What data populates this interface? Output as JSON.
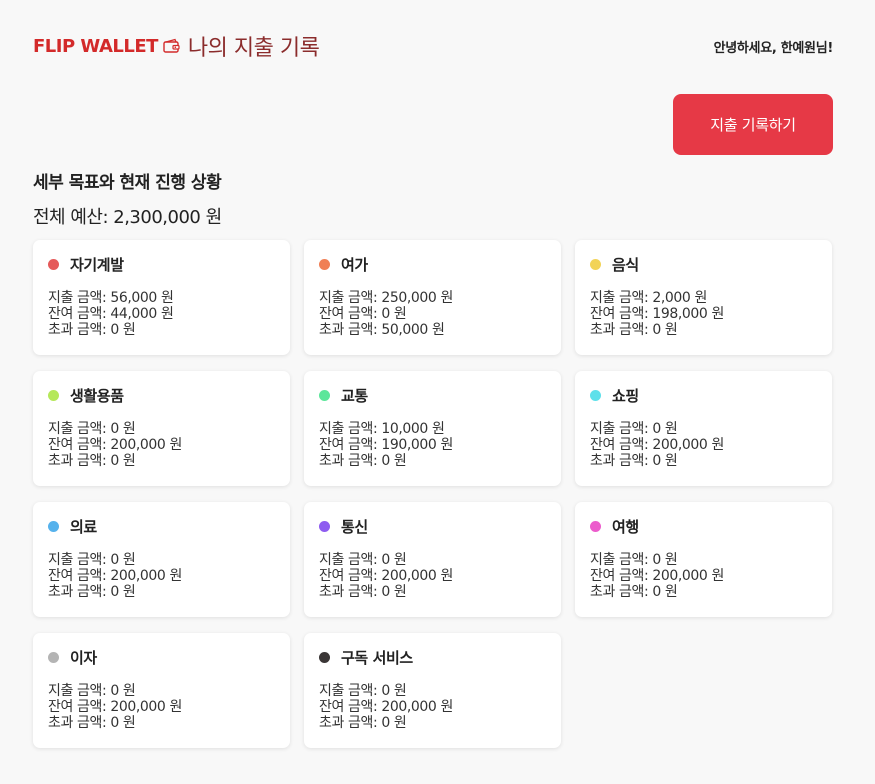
{
  "header": {
    "brand": "FLIP WALLET",
    "title": "나의 지출 기록",
    "greeting": "안녕하세요, 한예원님!"
  },
  "actions": {
    "record_label": "지출 기록하기"
  },
  "summary": {
    "section_title": "세부 목표와 현재 진행 상황",
    "total_budget": "전체 예산: 2,300,000 원"
  },
  "categories": [
    {
      "name": "자기계발",
      "color": "#e55a5a",
      "spent": "지출 금액: 56,000 원",
      "remaining": "잔여 금액: 44,000 원",
      "over": "초과 금액: 0 원"
    },
    {
      "name": "여가",
      "color": "#f07f55",
      "spent": "지출 금액: 250,000 원",
      "remaining": "잔여 금액: 0 원",
      "over": "초과 금액: 50,000 원"
    },
    {
      "name": "음식",
      "color": "#f2d357",
      "spent": "지출 금액: 2,000 원",
      "remaining": "잔여 금액: 198,000 원",
      "over": "초과 금액: 0 원"
    },
    {
      "name": "생활용품",
      "color": "#b5e85a",
      "spent": "지출 금액: 0 원",
      "remaining": "잔여 금액: 200,000 원",
      "over": "초과 금액: 0 원"
    },
    {
      "name": "교통",
      "color": "#5ce69a",
      "spent": "지출 금액: 10,000 원",
      "remaining": "잔여 금액: 190,000 원",
      "over": "초과 금액: 0 원"
    },
    {
      "name": "쇼핑",
      "color": "#5ee0ea",
      "spent": "지출 금액: 0 원",
      "remaining": "잔여 금액: 200,000 원",
      "over": "초과 금액: 0 원"
    },
    {
      "name": "의료",
      "color": "#56b2ec",
      "spent": "지출 금액: 0 원",
      "remaining": "잔여 금액: 200,000 원",
      "over": "초과 금액: 0 원"
    },
    {
      "name": "통신",
      "color": "#8e5cf0",
      "spent": "지출 금액: 0 원",
      "remaining": "잔여 금액: 200,000 원",
      "over": "초과 금액: 0 원"
    },
    {
      "name": "여행",
      "color": "#ec5ccc",
      "spent": "지출 금액: 0 원",
      "remaining": "잔여 금액: 200,000 원",
      "over": "초과 금액: 0 원"
    },
    {
      "name": "이자",
      "color": "#b4b4b4",
      "spent": "지출 금액: 0 원",
      "remaining": "잔여 금액: 200,000 원",
      "over": "초과 금액: 0 원"
    },
    {
      "name": "구독 서비스",
      "color": "#3a3636",
      "spent": "지출 금액: 0 원",
      "remaining": "잔여 금액: 200,000 원",
      "over": "초과 금액: 0 원"
    }
  ]
}
